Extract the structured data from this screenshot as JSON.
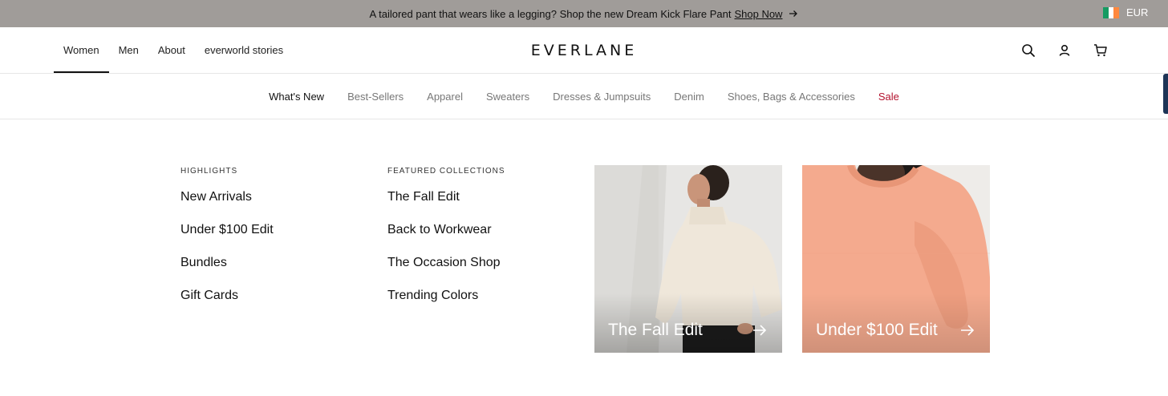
{
  "announcement": {
    "text": "A tailored pant that wears like a legging? Shop the new Dream Kick Flare Pant",
    "link": "Shop Now",
    "currency": "EUR",
    "flag_colors": [
      "#169b62",
      "#ffffff",
      "#ff883e"
    ]
  },
  "brand": {
    "logo": "EVERLANE"
  },
  "main_nav": {
    "items": [
      "Women",
      "Men",
      "About",
      "everworld stories"
    ],
    "active": "Women",
    "icons": [
      "search-icon",
      "account-icon",
      "cart-icon"
    ]
  },
  "sub_nav": {
    "items": [
      "What's New",
      "Best-Sellers",
      "Apparel",
      "Sweaters",
      "Dresses & Jumpsuits",
      "Denim",
      "Shoes, Bags & Accessories",
      "Sale"
    ],
    "current": "What's New",
    "sale_color": "#b3122e"
  },
  "dropdown": {
    "highlights": {
      "title": "HIGHLIGHTS",
      "links": [
        "New Arrivals",
        "Under $100 Edit",
        "Bundles",
        "Gift Cards"
      ]
    },
    "featured": {
      "title": "FEATURED COLLECTIONS",
      "links": [
        "The Fall Edit",
        "Back to Workwear",
        "The Occasion Shop",
        "Trending Colors"
      ]
    },
    "cards": [
      {
        "label": "The Fall Edit",
        "image": "model in cream turtleneck sweater"
      },
      {
        "label": "Under $100 Edit",
        "image": "peach crewneck sweater close-up"
      }
    ]
  }
}
